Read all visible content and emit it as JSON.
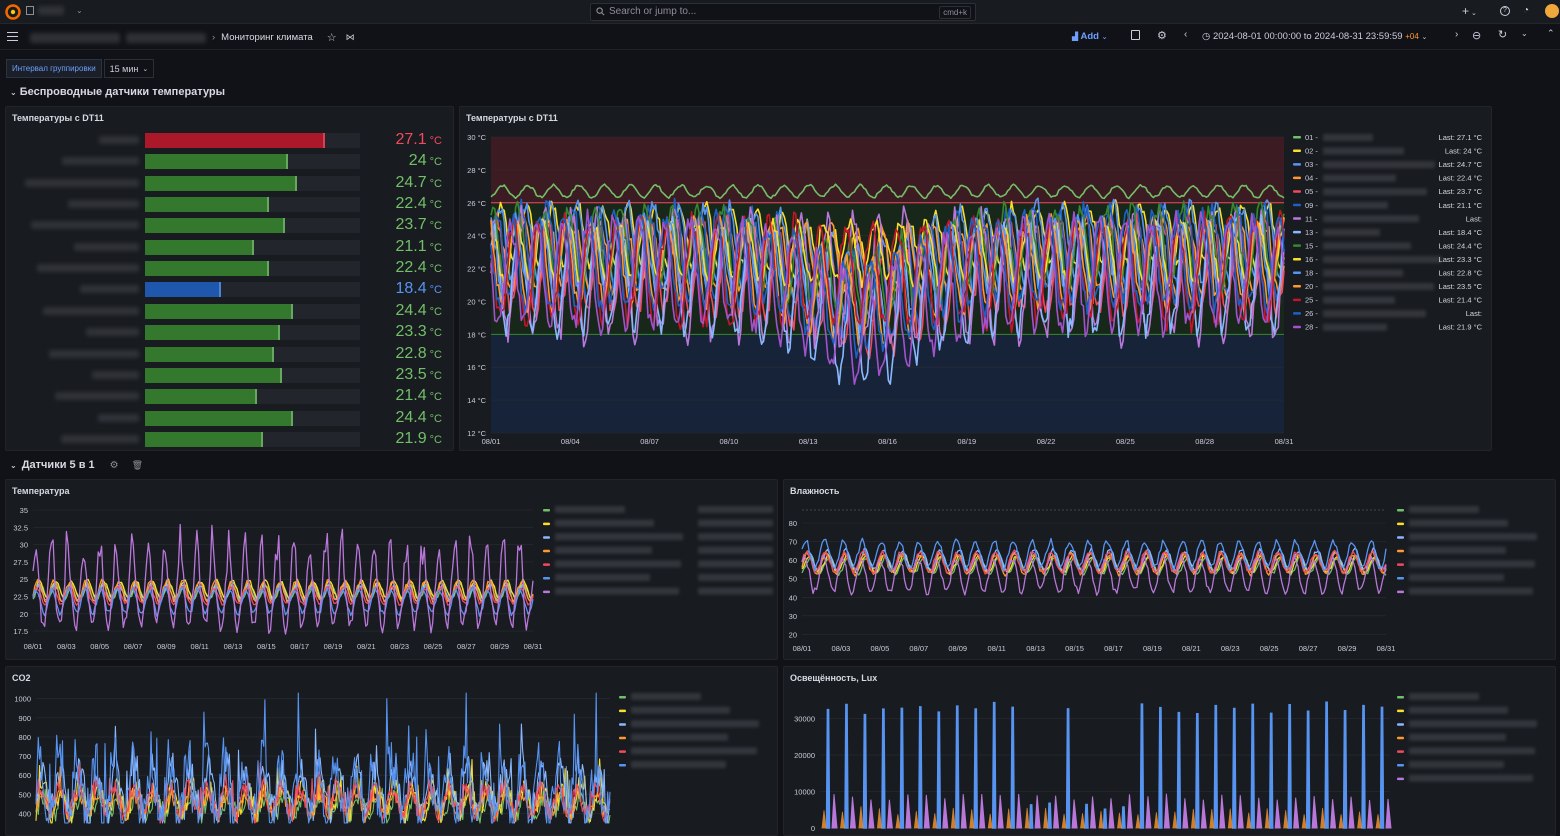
{
  "topbar": {
    "search_placeholder": "Search or jump to...",
    "search_shortcut": "cmd+k"
  },
  "navbar": {
    "breadcrumb_sep": "›",
    "dashboard_title": "Мониторинг климата",
    "add_label": "Add",
    "time_range": "2024-08-01 00:00:00 to 2024-08-31 23:59:59",
    "tz_offset": "+04"
  },
  "variables": {
    "interval_label": "Интервал группировки",
    "interval_value": "15 мин"
  },
  "rows": {
    "wireless": "Беспроводные датчики температуры",
    "five_in_one": "Датчики 5 в 1"
  },
  "colors": {
    "green": "#73bf69",
    "yellow": "#fade2a",
    "blue": "#5794f2",
    "orange": "#ff9830",
    "red": "#f2495c",
    "purple": "#b877d9",
    "dark_green": "#37872d",
    "dark_red": "#c4162a",
    "light_blue": "#8ab8ff",
    "dark_purple": "#8f3bb8",
    "dark_blue": "#1f60c4",
    "magenta": "#a352cc"
  },
  "bargauge": {
    "title": "Температуры с DT11",
    "min": 12,
    "max": 30,
    "items": [
      {
        "value": 27.1,
        "display": "27.1",
        "color": "#f2495c",
        "bar": "#c4162a"
      },
      {
        "value": 24,
        "display": "24",
        "color": "#73bf69",
        "bar": "#37872d"
      },
      {
        "value": 24.7,
        "display": "24.7",
        "color": "#73bf69",
        "bar": "#37872d"
      },
      {
        "value": 22.4,
        "display": "22.4",
        "color": "#73bf69",
        "bar": "#37872d"
      },
      {
        "value": 23.7,
        "display": "23.7",
        "color": "#73bf69",
        "bar": "#37872d"
      },
      {
        "value": 21.1,
        "display": "21.1",
        "color": "#73bf69",
        "bar": "#37872d"
      },
      {
        "value": 22.4,
        "display": "22.4",
        "color": "#73bf69",
        "bar": "#37872d"
      },
      {
        "value": 18.4,
        "display": "18.4",
        "color": "#5794f2",
        "bar": "#1f60c4"
      },
      {
        "value": 24.4,
        "display": "24.4",
        "color": "#73bf69",
        "bar": "#37872d"
      },
      {
        "value": 23.3,
        "display": "23.3",
        "color": "#73bf69",
        "bar": "#37872d"
      },
      {
        "value": 22.8,
        "display": "22.8",
        "color": "#73bf69",
        "bar": "#37872d"
      },
      {
        "value": 23.5,
        "display": "23.5",
        "color": "#73bf69",
        "bar": "#37872d"
      },
      {
        "value": 21.4,
        "display": "21.4",
        "color": "#73bf69",
        "bar": "#37872d"
      },
      {
        "value": 24.4,
        "display": "24.4",
        "color": "#73bf69",
        "bar": "#37872d"
      },
      {
        "value": 21.9,
        "display": "21.9",
        "color": "#73bf69",
        "bar": "#37872d"
      }
    ],
    "unit": "°C"
  },
  "chart_data": [
    {
      "type": "line",
      "title": "Температуры с DT11",
      "y_ticks": [
        "30 °C",
        "28 °C",
        "26 °C",
        "24 °C",
        "22 °C",
        "20 °C",
        "18 °C",
        "16 °C",
        "14 °C",
        "12 °C"
      ],
      "ylim": [
        12,
        30
      ],
      "x_ticks": [
        "08/01",
        "08/04",
        "08/07",
        "08/10",
        "08/13",
        "08/16",
        "08/19",
        "08/22",
        "08/25",
        "08/28",
        "08/31"
      ],
      "thresholds": [
        {
          "from": 26,
          "color": "#4a1f26"
        },
        {
          "from": 18,
          "color": "#16301a"
        },
        {
          "from": 12,
          "color": "#15263f"
        }
      ],
      "threshold_lines": [
        26,
        18
      ],
      "series": [
        {
          "name": "01",
          "color": "#73bf69",
          "base": 26.7,
          "amp": 0.4,
          "last": "Last: 27.1 °C"
        },
        {
          "name": "02",
          "color": "#fade2a",
          "base": 24.0,
          "amp": 2.0,
          "last": "Last: 24 °C"
        },
        {
          "name": "03",
          "color": "#5794f2",
          "base": 23.5,
          "amp": 2.6,
          "last": "Last: 24.7 °C"
        },
        {
          "name": "04",
          "color": "#ff9830",
          "base": 22.6,
          "amp": 2.2,
          "last": "Last: 22.4 °C"
        },
        {
          "name": "05",
          "color": "#f2495c",
          "base": 22.2,
          "amp": 3.0,
          "last": "Last: 23.7 °C"
        },
        {
          "name": "09",
          "color": "#1f60c4",
          "base": 23.0,
          "amp": 3.0,
          "last": "Last: 21.1 °C"
        },
        {
          "name": "11",
          "color": "#b877d9",
          "base": 21.5,
          "amp": 4.0,
          "last": "Last:"
        },
        {
          "name": "13",
          "color": "#8ab8ff",
          "base": 21.5,
          "amp": 3.5,
          "last": "Last: 18.4 °C"
        },
        {
          "name": "15",
          "color": "#37872d",
          "base": 23.3,
          "amp": 2.6,
          "last": "Last: 24.4 °C"
        },
        {
          "name": "16",
          "color": "#fade2a",
          "base": 23.0,
          "amp": 2.0,
          "last": "Last: 23.3 °C"
        },
        {
          "name": "18",
          "color": "#5794f2",
          "base": 22.8,
          "amp": 2.4,
          "last": "Last: 22.8 °C"
        },
        {
          "name": "20",
          "color": "#ff9830",
          "base": 22.3,
          "amp": 2.8,
          "last": "Last: 23.5 °C"
        },
        {
          "name": "25",
          "color": "#c4162a",
          "base": 21.8,
          "amp": 3.4,
          "last": "Last: 21.4 °C"
        },
        {
          "name": "26",
          "color": "#1f60c4",
          "base": 22.4,
          "amp": 3.0,
          "last": "Last:"
        },
        {
          "name": "28",
          "color": "#a352cc",
          "base": 21.7,
          "amp": 3.6,
          "last": "Last: 21.9 °C"
        }
      ]
    },
    {
      "type": "line",
      "title": "Температура",
      "y_ticks": [
        "35",
        "32.5",
        "30",
        "27.5",
        "25",
        "22.5",
        "20",
        "17.5"
      ],
      "ylim": [
        16.5,
        35
      ],
      "x_ticks": [
        "08/01",
        "08/03",
        "08/05",
        "08/07",
        "08/09",
        "08/11",
        "08/13",
        "08/15",
        "08/17",
        "08/19",
        "08/21",
        "08/23",
        "08/25",
        "08/27",
        "08/29",
        "08/31"
      ],
      "series": [
        {
          "color": "#73bf69",
          "base": 23.2,
          "amp": 1.2
        },
        {
          "color": "#fade2a",
          "base": 23.5,
          "amp": 1.4
        },
        {
          "color": "#8ab8ff",
          "base": 23.0,
          "amp": 1.3
        },
        {
          "color": "#ff9830",
          "base": 23.3,
          "amp": 1.6
        },
        {
          "color": "#f2495c",
          "base": 22.6,
          "amp": 1.3
        },
        {
          "color": "#5794f2",
          "base": 21.8,
          "amp": 2.0
        },
        {
          "color": "#b877d9",
          "base": 23.0,
          "amp": 5.5,
          "spiky": true
        }
      ]
    },
    {
      "type": "line",
      "title": "Влажность",
      "y_ticks": [
        "80",
        "70",
        "60",
        "50",
        "40",
        "30",
        "20"
      ],
      "ylim": [
        17,
        87
      ],
      "x_ticks": [
        "08/01",
        "08/03",
        "08/05",
        "08/07",
        "08/09",
        "08/11",
        "08/13",
        "08/15",
        "08/17",
        "08/19",
        "08/21",
        "08/23",
        "08/25",
        "08/27",
        "08/29",
        "08/31"
      ],
      "series": [
        {
          "color": "#73bf69",
          "base": 57,
          "amp": 5
        },
        {
          "color": "#fade2a",
          "base": 58,
          "amp": 5
        },
        {
          "color": "#8ab8ff",
          "base": 60,
          "amp": 6
        },
        {
          "color": "#ff9830",
          "base": 58,
          "amp": 6
        },
        {
          "color": "#f2495c",
          "base": 59,
          "amp": 6
        },
        {
          "color": "#5794f2",
          "base": 63,
          "amp": 8
        },
        {
          "color": "#b877d9",
          "base": 52,
          "amp": 10
        }
      ]
    },
    {
      "type": "line",
      "title": "CO2",
      "y_ticks": [
        "1000",
        "900",
        "800",
        "700",
        "600",
        "500",
        "400"
      ],
      "ylim": [
        350,
        1030
      ],
      "series": [
        {
          "color": "#73bf69",
          "base": 440,
          "amp": 60
        },
        {
          "color": "#fade2a",
          "base": 470,
          "amp": 80
        },
        {
          "color": "#8ab8ff",
          "base": 520,
          "amp": 130
        },
        {
          "color": "#ff9830",
          "base": 450,
          "amp": 60
        },
        {
          "color": "#f2495c",
          "base": 470,
          "amp": 80
        },
        {
          "color": "#5794f2",
          "base": 520,
          "amp": 180
        }
      ]
    },
    {
      "type": "line",
      "title": "Освещённость, Lux",
      "y_ticks": [
        "30000",
        "20000",
        "10000",
        "0"
      ],
      "ylim": [
        0,
        37000
      ]
    }
  ]
}
